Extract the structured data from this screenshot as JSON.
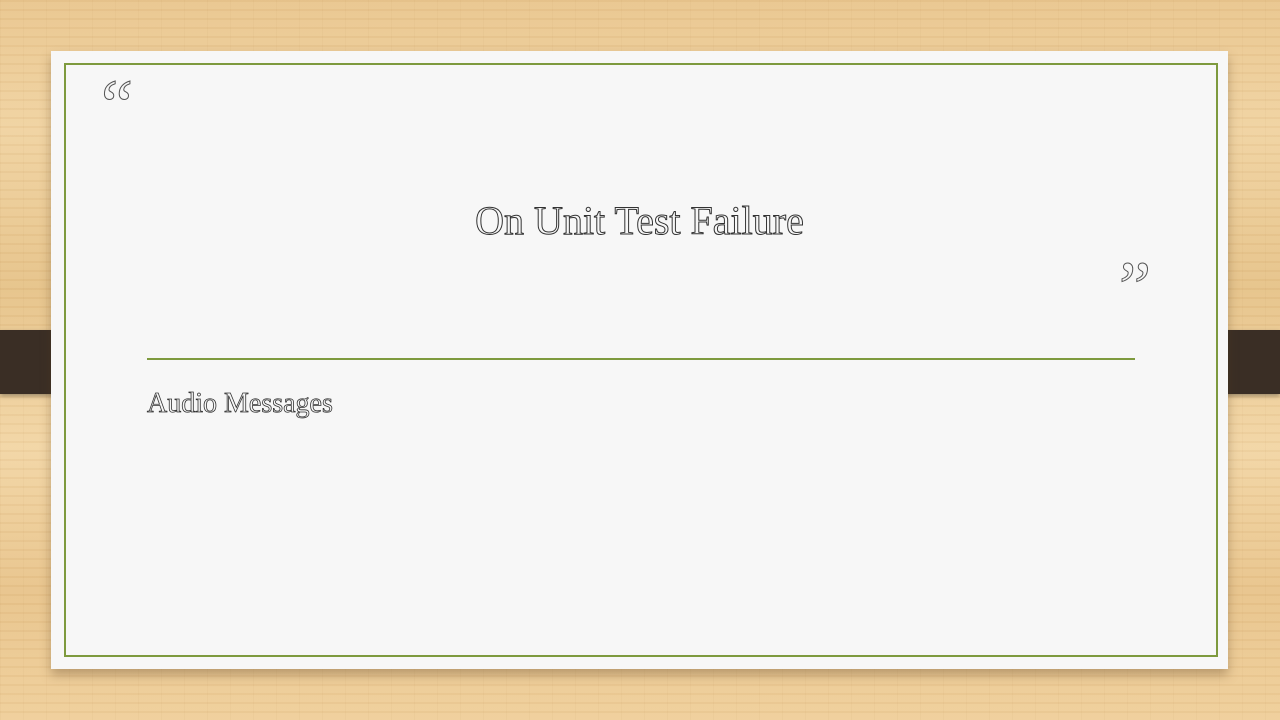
{
  "slide": {
    "title": "On Unit Test Failure",
    "subtitle": "Audio Messages",
    "quote_open": "“",
    "quote_close": "”"
  },
  "colors": {
    "accent": "#7e9a3e",
    "card": "#f7f7f7",
    "strap": "#3a2e25",
    "background": "#e9c68f"
  }
}
